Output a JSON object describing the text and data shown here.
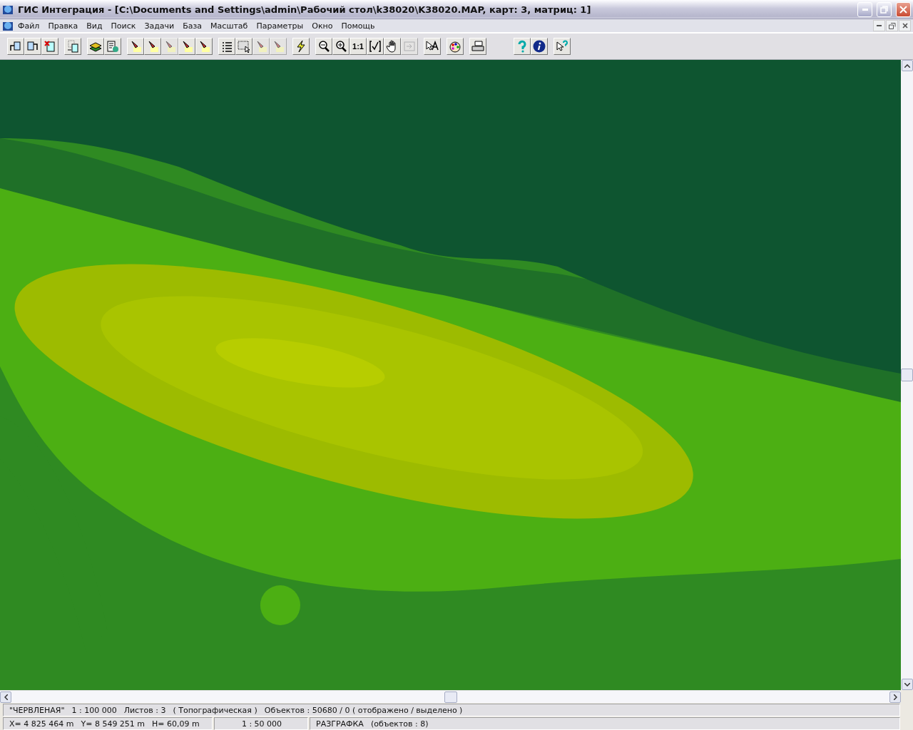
{
  "window": {
    "title": "ГИС Интеграция - [C:\\Documents and Settings\\admin\\Рабочий стол\\k38020\\K38020.MAP, карт: 3, матриц: 1]"
  },
  "menu": [
    "Файл",
    "Правка",
    "Вид",
    "Поиск",
    "Задачи",
    "База",
    "Масштаб",
    "Параметры",
    "Окно",
    "Помощь"
  ],
  "toolbar": [
    [
      {
        "kind": "open",
        "disabled": false
      },
      {
        "kind": "swap",
        "disabled": false
      },
      {
        "kind": "close-doc",
        "disabled": false
      }
    ],
    [
      {
        "kind": "import",
        "disabled": false
      }
    ],
    [
      {
        "kind": "layers",
        "disabled": false
      },
      {
        "kind": "doc",
        "disabled": false
      }
    ],
    [
      {
        "kind": "pick",
        "disabled": false
      },
      {
        "kind": "pick",
        "disabled": false
      },
      {
        "kind": "pick",
        "disabled": true
      },
      {
        "kind": "pick",
        "disabled": false
      },
      {
        "kind": "pick",
        "disabled": false
      }
    ],
    [
      {
        "kind": "list",
        "disabled": false
      },
      {
        "kind": "select",
        "disabled": false
      },
      {
        "kind": "pick",
        "disabled": true
      },
      {
        "kind": "pick",
        "disabled": true
      }
    ],
    [
      {
        "kind": "flash",
        "disabled": false
      }
    ],
    [
      {
        "kind": "zoom-out",
        "disabled": false
      },
      {
        "kind": "zoom-in",
        "disabled": false
      },
      {
        "kind": "scale",
        "label": "1:1",
        "disabled": false
      },
      {
        "kind": "fit",
        "disabled": false
      },
      {
        "kind": "hand",
        "disabled": false
      },
      {
        "kind": "go",
        "disabled": true
      }
    ],
    [
      {
        "kind": "text",
        "disabled": false
      }
    ],
    [
      {
        "kind": "palette",
        "disabled": false
      }
    ],
    [
      {
        "kind": "print",
        "disabled": false
      }
    ],
    [
      {
        "kind": "help",
        "disabled": false
      },
      {
        "kind": "info",
        "disabled": false
      }
    ],
    [
      {
        "kind": "whatis",
        "disabled": false
      }
    ]
  ],
  "status_bar": {
    "row_1": [
      "\"ЧЕРВЛЕНАЯ\"",
      "1 : 100 000",
      "Листов : 3",
      "( Топографическая )",
      "Объектов : 50680 / 0 ( отображено / выделено )"
    ],
    "row_2": [
      [
        "X=  4 825 464 m",
        "Y=  8 549 251 m",
        "H=  60,09 m"
      ],
      [
        "1 : 50 000"
      ],
      [
        "РАЗГРАФКА",
        "(объектов : 8)"
      ]
    ]
  }
}
